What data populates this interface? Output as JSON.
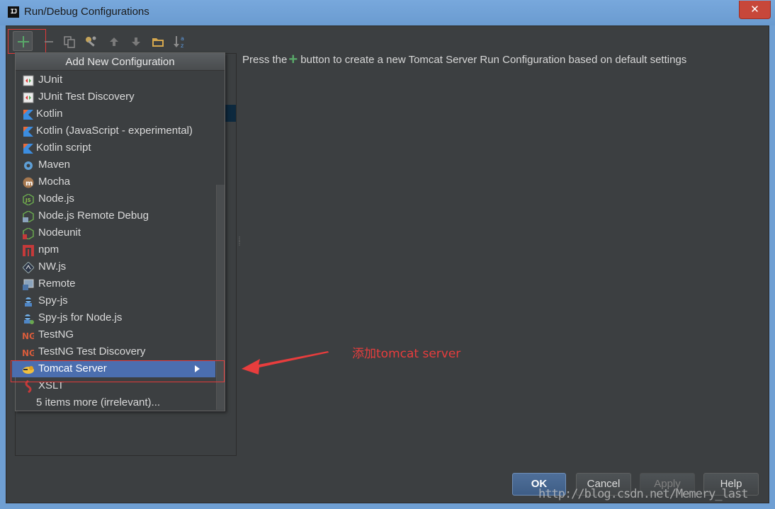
{
  "window": {
    "app_icon_text": "IJ",
    "title": "Run/Debug Configurations",
    "close_symbol": "✕"
  },
  "toolbar": {
    "icons": [
      "add-icon",
      "remove-icon",
      "copy-icon",
      "edit-defaults-icon",
      "move-up-icon",
      "move-down-icon",
      "folder-icon",
      "sort-icon"
    ]
  },
  "popup": {
    "header": "Add New Configuration",
    "items": [
      {
        "label": "JUnit",
        "icon": "junit-icon"
      },
      {
        "label": "JUnit Test Discovery",
        "icon": "junit-icon"
      },
      {
        "label": "Kotlin",
        "icon": "kotlin-icon"
      },
      {
        "label": "Kotlin (JavaScript - experimental)",
        "icon": "kotlin-icon"
      },
      {
        "label": "Kotlin script",
        "icon": "kotlin-icon"
      },
      {
        "label": "Maven",
        "icon": "maven-icon"
      },
      {
        "label": "Mocha",
        "icon": "mocha-icon"
      },
      {
        "label": "Node.js",
        "icon": "nodejs-icon"
      },
      {
        "label": "Node.js Remote Debug",
        "icon": "nodejs-remote-icon"
      },
      {
        "label": "Nodeunit",
        "icon": "nodejs-icon"
      },
      {
        "label": "npm",
        "icon": "npm-icon"
      },
      {
        "label": "NW.js",
        "icon": "nwjs-icon"
      },
      {
        "label": "Remote",
        "icon": "remote-icon"
      },
      {
        "label": "Spy-js",
        "icon": "spyjs-icon"
      },
      {
        "label": "Spy-js for Node.js",
        "icon": "spyjs-icon"
      },
      {
        "label": "TestNG",
        "icon": "testng-icon"
      },
      {
        "label": "TestNG Test Discovery",
        "icon": "testng-icon"
      },
      {
        "label": "Tomcat Server",
        "icon": "tomcat-icon"
      },
      {
        "label": "XSLT",
        "icon": "xslt-icon"
      },
      {
        "label": "5 items more (irrelevant)...",
        "icon": ""
      }
    ],
    "selected_item": "Tomcat Server"
  },
  "description": {
    "before": "Press the",
    "after": "button to create a new Tomcat Server Run Configuration based on default settings"
  },
  "annotation": {
    "text": "添加tomcat server",
    "color": "#e83d3d"
  },
  "buttons": {
    "ok": "OK",
    "cancel": "Cancel",
    "apply": "Apply",
    "help": "Help"
  },
  "watermark": "http://blog.csdn.net/Memery_last",
  "colors": {
    "background": "#3c3f41",
    "selection": "#4b6eaf",
    "titlebar": "#6f9fd3",
    "add_green": "#59a869"
  }
}
